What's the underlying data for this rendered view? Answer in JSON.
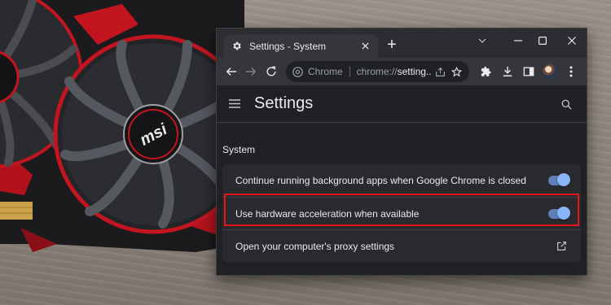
{
  "window": {
    "tab_title": "Settings - System",
    "new_tab_symbol": "+",
    "controls": [
      "chevron-down-icon",
      "minimize-icon",
      "maximize-icon",
      "close-icon"
    ]
  },
  "toolbar": {
    "site_chip": "Chrome",
    "url_scheme": "chrome://",
    "url_path": "setting..."
  },
  "settings": {
    "title": "Settings",
    "section": "System",
    "rows": [
      {
        "label": "Continue running background apps when Google Chrome is closed",
        "control": "toggle",
        "on": true
      },
      {
        "label": "Use hardware acceleration when available",
        "control": "toggle",
        "on": true,
        "highlighted": true
      },
      {
        "label": "Open your computer's proxy settings",
        "control": "external-link"
      }
    ]
  },
  "colors": {
    "accent": "#8ab4f8",
    "highlight": "#e3141b",
    "background": "#202124",
    "card": "#292a2d"
  },
  "background_image": {
    "logo_text": "msi"
  }
}
